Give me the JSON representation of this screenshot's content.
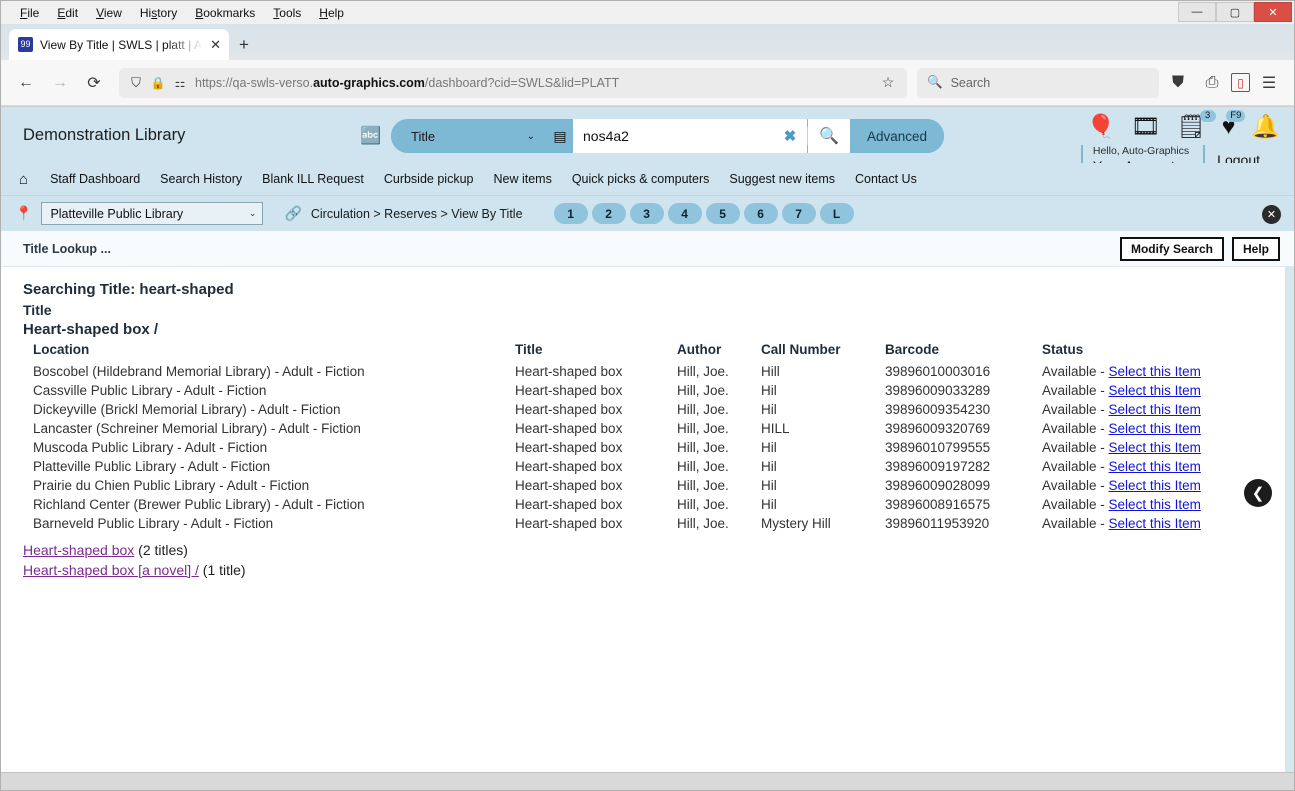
{
  "browser": {
    "menus": [
      "File",
      "Edit",
      "View",
      "History",
      "Bookmarks",
      "Tools",
      "Help"
    ],
    "window_buttons": {
      "minimize": "—",
      "maximize": "▢",
      "close": "✕"
    },
    "tab": {
      "title": "View By Title | SWLS | platt | Aut",
      "close": "✕",
      "favicon": "99"
    },
    "new_tab": "+",
    "nav": {
      "back": "←",
      "forward": "→",
      "reload": "⟳"
    },
    "url": {
      "scheme": "https://qa-swls-verso.",
      "domain": "auto-graphics.com",
      "path": "/dashboard?cid=SWLS&lid=PLATT"
    },
    "url_full": "https://qa-swls-verso.auto-graphics.com/dashboard?cid=SWLS&lid=PLATT",
    "bookmark_star": "☆",
    "search": {
      "icon": "search-icon",
      "placeholder": "Search"
    },
    "toolbar_icons": [
      "pocket-icon",
      "print-icon",
      "shield-icon",
      "menu-icon"
    ]
  },
  "app": {
    "brand": "Demonstration Library",
    "search": {
      "translate_icon": "translate-icon",
      "scope": "Title",
      "scope_chevron": "⌄",
      "database_icon": "database-icon",
      "query": "nos4a2",
      "clear": "✖",
      "go_icon": "search-icon",
      "advanced_label": "Advanced"
    },
    "header_icons": [
      {
        "name": "balloon-icon",
        "glyph": "🎈",
        "badge": ""
      },
      {
        "name": "film-search-icon",
        "glyph": "🎞",
        "badge": ""
      },
      {
        "name": "list-icon",
        "glyph": "🗒",
        "badge": "3"
      },
      {
        "name": "heart-icon",
        "glyph": "♥",
        "badge": "F9"
      },
      {
        "name": "bell-icon",
        "glyph": "🔔",
        "badge": ""
      }
    ],
    "account": {
      "hello": "Hello, Auto-Graphics",
      "your_account": "Your Account",
      "chevron": "⌄",
      "logout": "Logout"
    },
    "nav_items": [
      "Staff Dashboard",
      "Search History",
      "Blank ILL Request",
      "Curbside pickup",
      "New items",
      "Quick picks & computers",
      "Suggest new items",
      "Contact Us"
    ],
    "home_icon": "home-icon"
  },
  "crumbbar": {
    "pin_icon": "location-pin-icon",
    "library": "Platteville Public Library",
    "library_chevron": "⌄",
    "link_icon": "link-icon",
    "breadcrumb": "Circulation > Reserves > View By Title",
    "pills": [
      "1",
      "2",
      "3",
      "4",
      "5",
      "6",
      "7",
      "L"
    ],
    "close": "✕"
  },
  "lookup": {
    "title": "Title Lookup ...",
    "modify_search": "Modify Search",
    "help": "Help"
  },
  "results": {
    "searching_line": "Searching Title: heart-shaped",
    "title_label": "Title",
    "group_title": "Heart-shaped box /",
    "headers": [
      "Location",
      "Title",
      "Author",
      "Call Number",
      "Barcode",
      "Status"
    ],
    "status_prefix": "Available - ",
    "select_link": "Select this Item",
    "rows": [
      {
        "location": "Boscobel (Hildebrand Memorial Library) - Adult - Fiction",
        "title": "Heart-shaped box",
        "author": "Hill, Joe.",
        "call": "Hill",
        "barcode": "39896010003016",
        "status": "Available - "
      },
      {
        "location": "Cassville Public Library - Adult - Fiction",
        "title": "Heart-shaped box",
        "author": "Hill, Joe.",
        "call": "Hil",
        "barcode": "39896009033289",
        "status": "Available - "
      },
      {
        "location": "Dickeyville (Brickl Memorial Library) - Adult - Fiction",
        "title": "Heart-shaped box",
        "author": "Hill, Joe.",
        "call": "Hil",
        "barcode": "39896009354230",
        "status": "Available - "
      },
      {
        "location": "Lancaster (Schreiner Memorial Library) - Adult - Fiction",
        "title": "Heart-shaped box",
        "author": "Hill, Joe.",
        "call": "HILL",
        "barcode": "39896009320769",
        "status": "Available - "
      },
      {
        "location": "Muscoda Public Library - Adult - Fiction",
        "title": "Heart-shaped box",
        "author": "Hill, Joe.",
        "call": "Hil",
        "barcode": "39896010799555",
        "status": "Available - "
      },
      {
        "location": "Platteville Public Library - Adult - Fiction",
        "title": "Heart-shaped box",
        "author": "Hill, Joe.",
        "call": "Hil",
        "barcode": "39896009197282",
        "status": "Available - "
      },
      {
        "location": "Prairie du Chien Public Library - Adult - Fiction",
        "title": "Heart-shaped box",
        "author": "Hill, Joe.",
        "call": "Hil",
        "barcode": "39896009028099",
        "status": "Available - "
      },
      {
        "location": "Richland Center (Brewer Public Library) - Adult - Fiction",
        "title": "Heart-shaped box",
        "author": "Hill, Joe.",
        "call": "Hil",
        "barcode": "39896008916575",
        "status": "Available - "
      },
      {
        "location": "Barneveld Public Library - Adult - Fiction",
        "title": "Heart-shaped box",
        "author": "Hill, Joe.",
        "call": "Mystery Hill",
        "barcode": "39896011953920",
        "status": "Available - "
      }
    ],
    "extra_links": [
      {
        "link": "Heart-shaped box",
        "suffix": " (2 titles)"
      },
      {
        "link": "Heart-shaped box [a novel] /",
        "suffix": " (1 title)"
      }
    ],
    "back_button": "❮"
  },
  "colors": {
    "header_bg": "#cfe4ef",
    "accent": "#7db8d5",
    "pill": "#8fc4dc",
    "link": "#1414d6",
    "visited_link": "#7b2b8f"
  }
}
